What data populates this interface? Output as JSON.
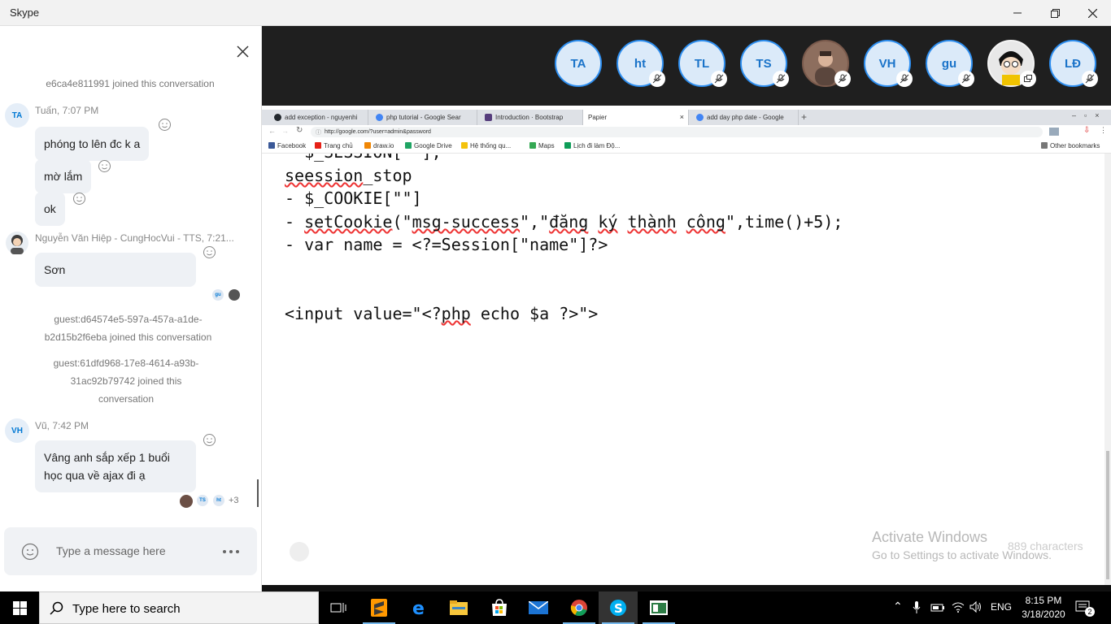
{
  "window": {
    "title": "Skype"
  },
  "chat": {
    "messages_sys": [
      "e6ca4e811991 joined this conversation",
      "guest:d64574e5-597a-457a-a1de-b2d15b2f6eba joined this conversation",
      "guest:61dfd968-17e8-4614-a93b-31ac92b79742 joined this conversation"
    ],
    "groups": [
      {
        "avatar": "TA",
        "sender": "Tuấn, 7:07 PM",
        "bubbles": [
          "phóng to lên đc k a",
          "mờ lắm",
          "ok"
        ]
      },
      {
        "avatar": "",
        "sender": "Nguyễn Văn Hiệp - CungHocVui - TTS, 7:21...",
        "bubbles": [
          "Sơn"
        ]
      },
      {
        "avatar": "VH",
        "sender": "Vũ, 7:42 PM",
        "bubbles": [
          "Vâng anh sắp xếp 1 buổi học qua về ajax đi ạ"
        ]
      }
    ],
    "read_receipts_1": [
      "gu"
    ],
    "read_receipts_2": [
      "TS",
      "ht"
    ],
    "more_count": "+3",
    "input": {
      "placeholder": "Type a message here"
    }
  },
  "call": {
    "participants": [
      {
        "initials": "TA",
        "muted": false
      },
      {
        "initials": "ht",
        "muted": true
      },
      {
        "initials": "TL",
        "muted": true
      },
      {
        "initials": "TS",
        "muted": true
      },
      {
        "initials": "",
        "muted": true,
        "photo": true
      },
      {
        "initials": "VH",
        "muted": true
      },
      {
        "initials": "gu",
        "muted": true
      },
      {
        "initials": "",
        "muted": false,
        "photo": true,
        "self": true
      },
      {
        "initials": "LĐ",
        "muted": true
      }
    ]
  },
  "browser": {
    "tabs": [
      {
        "label": "add exception - nguyenhi",
        "color": "#24292e"
      },
      {
        "label": "php tutorial - Google Sear",
        "color": "#4285f4"
      },
      {
        "label": "Introduction · Bootstrap",
        "color": "#563d7c"
      },
      {
        "label": "Papier",
        "color": "#ffffff",
        "active": true
      },
      {
        "label": "add day php date - Google",
        "color": "#4285f4"
      }
    ],
    "url": "http://google.com/?user=admin&password",
    "bookmarks": [
      {
        "label": "Facebook",
        "color": "#3b5998"
      },
      {
        "label": "Trang chủ",
        "color": "#e62117"
      },
      {
        "label": "draw.io",
        "color": "#f08705"
      },
      {
        "label": "Google Drive",
        "color": "#1fa463"
      },
      {
        "label": "Hệ thống qu...",
        "color": "#f4c20d"
      },
      {
        "label": "Maps",
        "color": "#34a853"
      },
      {
        "label": "Lịch đi làm Độ...",
        "color": "#0f9d58"
      }
    ],
    "other_bookmarks": "Other bookmarks"
  },
  "editor": {
    "line0": "- $_SESSION[\"\"];",
    "line1_word": "seession",
    "line1_rest": "_stop",
    "line2": "- $_COOKIE[\"\"]",
    "line3_a": "- ",
    "line3_b": "setCookie",
    "line3_c": "(\"",
    "line3_d": "msg-success",
    "line3_e": "\",\"",
    "line3_f": "đăng",
    "line3_g": " ",
    "line3_h": "ký",
    "line3_i": " ",
    "line3_j": "thành",
    "line3_k": " ",
    "line3_l": "công",
    "line3_m": "\",time()+5);",
    "line4": "- var name = <?=Session[\"name\"]?>",
    "line5_a": "<input value=\"<?",
    "line5_b": "php",
    "line5_c": " echo $a ?>\">",
    "char_count": "889 characters",
    "activate_title": "Activate Windows",
    "activate_sub": "Go to Settings to activate Windows."
  },
  "taskbar": {
    "search_placeholder": "Type here to search",
    "lang": "ENG",
    "time": "8:15 PM",
    "date": "3/18/2020",
    "notif_count": "2"
  }
}
